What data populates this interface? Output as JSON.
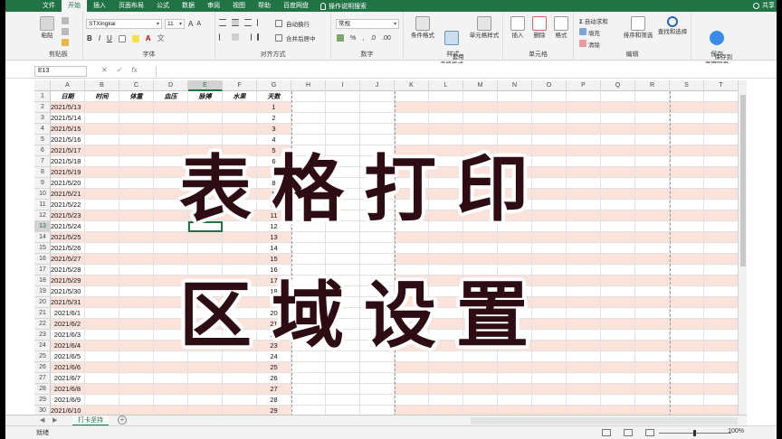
{
  "tabs": [
    "文件",
    "开始",
    "插入",
    "页面布局",
    "公式",
    "数据",
    "审阅",
    "视图",
    "帮助",
    "百度网盘"
  ],
  "active_tab": "开始",
  "tell_me": "操作说明搜索",
  "share": "共享",
  "ribbon": {
    "paste": "粘贴",
    "clipboard": "剪贴板",
    "font_name": "STXingkai",
    "font_size": "11",
    "font_group": "字体",
    "wrap_text": "自动换行",
    "merge_center": "合并后居中",
    "align_group": "对齐方式",
    "number_format": "常规",
    "number_group": "数字",
    "cond_format": "条件格式",
    "table_format": "套用\n表格格式",
    "cell_styles": "单元格样式",
    "styles_group": "样式",
    "insert": "插入",
    "delete": "删除",
    "format": "格式",
    "cells_group": "单元格",
    "autosum": "自动求和",
    "fill": "填充",
    "clear": "清除",
    "sort_filter": "排序和筛选",
    "find_select": "查找和选择",
    "edit_group": "编辑",
    "save_baidu": "保存到\n百度网盘",
    "save_group": "保存"
  },
  "name_box": "E13",
  "columns": [
    "A",
    "B",
    "C",
    "D",
    "E",
    "F",
    "G",
    "H",
    "I",
    "J",
    "K",
    "L",
    "M",
    "N",
    "O",
    "P",
    "Q",
    "R",
    "S",
    "T"
  ],
  "selected_column": "E",
  "selected_row": 13,
  "header_row": [
    "日期",
    "时间",
    "体重",
    "血压",
    "脉搏",
    "水果",
    "天数"
  ],
  "rows": [
    {
      "n": 2,
      "date": "2021/5/13",
      "day": "1"
    },
    {
      "n": 3,
      "date": "2021/5/14",
      "day": "2"
    },
    {
      "n": 4,
      "date": "2021/5/15",
      "day": "3"
    },
    {
      "n": 5,
      "date": "2021/5/16",
      "day": "4"
    },
    {
      "n": 6,
      "date": "2021/5/17",
      "day": "5"
    },
    {
      "n": 7,
      "date": "2021/5/18",
      "day": "6"
    },
    {
      "n": 8,
      "date": "2021/5/19",
      "day": "7"
    },
    {
      "n": 9,
      "date": "2021/5/20",
      "day": "8"
    },
    {
      "n": 10,
      "date": "2021/5/21",
      "day": "9"
    },
    {
      "n": 11,
      "date": "2021/5/22",
      "day": "10"
    },
    {
      "n": 12,
      "date": "2021/5/23",
      "day": "11"
    },
    {
      "n": 13,
      "date": "2021/5/24",
      "day": "12"
    },
    {
      "n": 14,
      "date": "2021/5/25",
      "day": "13"
    },
    {
      "n": 15,
      "date": "2021/5/26",
      "day": "14"
    },
    {
      "n": 16,
      "date": "2021/5/27",
      "day": "15"
    },
    {
      "n": 17,
      "date": "2021/5/28",
      "day": "16"
    },
    {
      "n": 18,
      "date": "2021/5/29",
      "day": "17"
    },
    {
      "n": 19,
      "date": "2021/5/30",
      "day": "18"
    },
    {
      "n": 20,
      "date": "2021/5/31",
      "day": "19"
    },
    {
      "n": 21,
      "date": "2021/6/1",
      "day": "20"
    },
    {
      "n": 22,
      "date": "2021/6/2",
      "day": "21"
    },
    {
      "n": 23,
      "date": "2021/6/3",
      "day": "22"
    },
    {
      "n": 24,
      "date": "2021/6/4",
      "day": "23"
    },
    {
      "n": 25,
      "date": "2021/6/5",
      "day": "24"
    },
    {
      "n": 26,
      "date": "2021/6/6",
      "day": "25"
    },
    {
      "n": 27,
      "date": "2021/6/7",
      "day": "26"
    },
    {
      "n": 28,
      "date": "2021/6/8",
      "day": "27"
    },
    {
      "n": 29,
      "date": "2021/6/9",
      "day": "28"
    },
    {
      "n": 30,
      "date": "2021/6/10",
      "day": "29"
    }
  ],
  "overlay": {
    "line1": "表格打印",
    "line2": "区域设置"
  },
  "sheet_tab": "打卡坚持",
  "status": {
    "ready": "就绪",
    "zoom": "100%"
  },
  "colors": {
    "accent": "#217346",
    "stripe": "#fbe3dc",
    "title": "#2d0c14"
  }
}
